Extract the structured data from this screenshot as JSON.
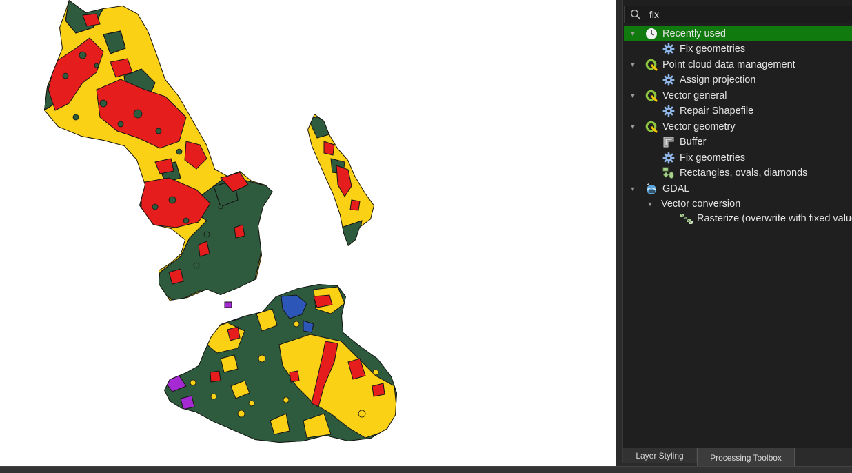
{
  "map": {
    "colors": {
      "forest": "#2e5b3d",
      "yellow": "#fbd116",
      "red": "#e61d1d",
      "blue": "#2c57b8",
      "purple": "#a52ad2",
      "outline": "#151515"
    }
  },
  "search": {
    "value": "fix",
    "icon": "search-icon"
  },
  "tree": {
    "items": [
      {
        "label": "Recently used",
        "icon": "clock-icon",
        "expanded": true,
        "selected": true
      },
      {
        "label": "Fix geometries",
        "icon": "gear-icon"
      },
      {
        "label": "Point cloud data management",
        "icon": "qgis-icon",
        "expanded": true
      },
      {
        "label": "Assign projection",
        "icon": "gear-icon"
      },
      {
        "label": "Vector general",
        "icon": "qgis-icon",
        "expanded": true
      },
      {
        "label": "Repair Shapefile",
        "icon": "gear-icon"
      },
      {
        "label": "Vector geometry",
        "icon": "qgis-icon",
        "expanded": true
      },
      {
        "label": "Buffer",
        "icon": "buffer-icon"
      },
      {
        "label": "Fix geometries",
        "icon": "gear-icon"
      },
      {
        "label": "Rectangles, ovals, diamonds",
        "icon": "shapes-icon"
      },
      {
        "label": "GDAL",
        "icon": "gdal-icon",
        "expanded": true
      },
      {
        "label": "Vector conversion",
        "expanded": true
      },
      {
        "label": "Rasterize (overwrite with fixed value)",
        "icon": "rasterize-icon"
      }
    ]
  },
  "tabs": {
    "layer_styling": "Layer Styling",
    "processing_toolbox": "Processing Toolbox"
  }
}
